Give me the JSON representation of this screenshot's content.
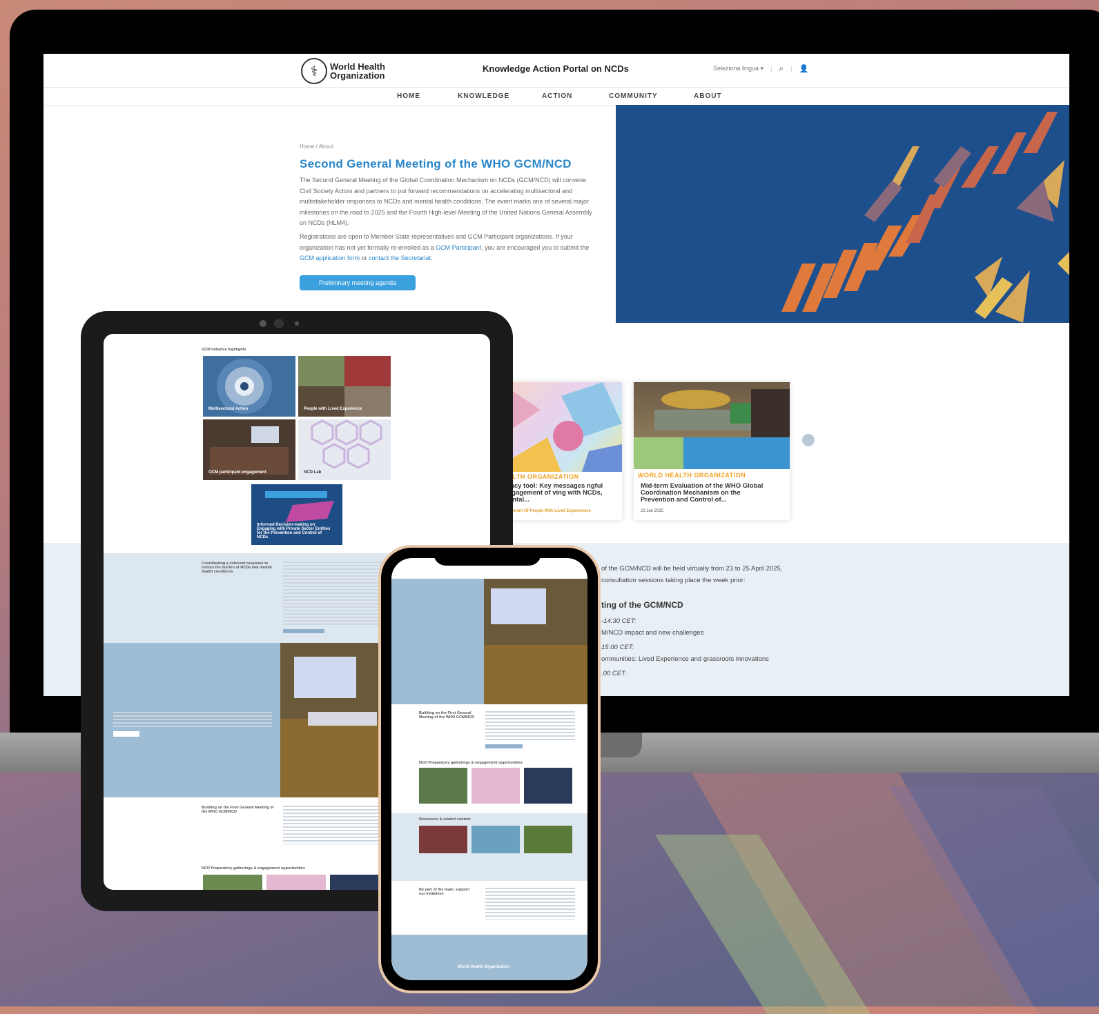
{
  "laptop": {
    "logo": {
      "line1": "World Health",
      "line2": "Organization"
    },
    "portal_title": "Knowledge Action Portal on NCDs",
    "language_select": "Seleziona lingua ▾",
    "nav": [
      "HOME",
      "KNOWLEDGE",
      "ACTION",
      "COMMUNITY",
      "ABOUT"
    ],
    "breadcrumb": "Home / About",
    "heading": "Second General Meeting of the WHO GCM/NCD",
    "para1": "The Second General Meeting of the Global Coordination Mechanism on NCDs (GCM/NCD) will convene Civil Society Actors and partners to put forward recommendations on accelerating multisectoral and multistakeholder responses to NCDs and mental health conditions. The event marks one of several major milestones on the road to 2025 and the Fourth High-level Meeting of the United Nations General Assembly on NCDs (HLM4).",
    "para2_a": "Registrations are open to Member State representatives and GCM Participant organizations. If your organization has not yet formally re-enrolled as a ",
    "para2_link1": "GCM Participant",
    "para2_b": ", you are encouraged you to submit the ",
    "para2_link2": "GCM application form",
    "para2_c": " or ",
    "para2_link3": "contact the Secretariat",
    "para2_d": ".",
    "cta": "Preliminary meeting agenda",
    "cards": [
      {
        "kicker": "EALTH ORGANIZATION",
        "title": "acacy tool: Key messages ngful Engagement of ving with NCDs, Mental...",
        "tag": "gagement Of People With Lived Experiences"
      },
      {
        "kicker": "WORLD HEALTH ORGANIZATION",
        "title": "Mid-term Evaluation of the WHO Global Coordination Mechanism on the Prevention and Control of...",
        "date": "23 Jan 2025"
      }
    ],
    "agenda": {
      "line1": "of the GCM/NCD will be held virtually from 23 to 25 April 2025,",
      "line2": "consultation sessions taking place the week prior:",
      "heading": "ting of the GCM/NCD",
      "items": [
        "-14:30 CET:",
        "M/NCD impact and new challenges",
        "15:00 CET:",
        "ommunities: Lived Experience and grassroots innovations",
        ".00 CET:"
      ]
    }
  },
  "tablet": {
    "section_title": "GCM initiative highlights",
    "tiles": [
      "Multisectoral Action",
      "People with Lived Experience",
      "GCM participant engagement",
      "NCD Lab",
      "Informed Decision-making on Engaging with Private Sector Entities for the Prevention and Control of NCDs"
    ],
    "coord_heading": "Coordinating a coherent response to reduce the burden of NCDs and mental health conditions",
    "building_heading": "Building on the First General Meeting of the WHO GCM/NCD",
    "gatherings_heading": "NCD Preparatory gatherings & engagement opportunities"
  },
  "phone": {
    "building_heading": "Building on the First General Meeting of the WHO GCM/NCD",
    "gatherings_heading": "NCD Preparatory gatherings & engagement opportunities",
    "resources_heading": "Resources & related content",
    "team_heading": "Be part of the team, support our initiatives",
    "footer_logo": "World Health Organization"
  }
}
